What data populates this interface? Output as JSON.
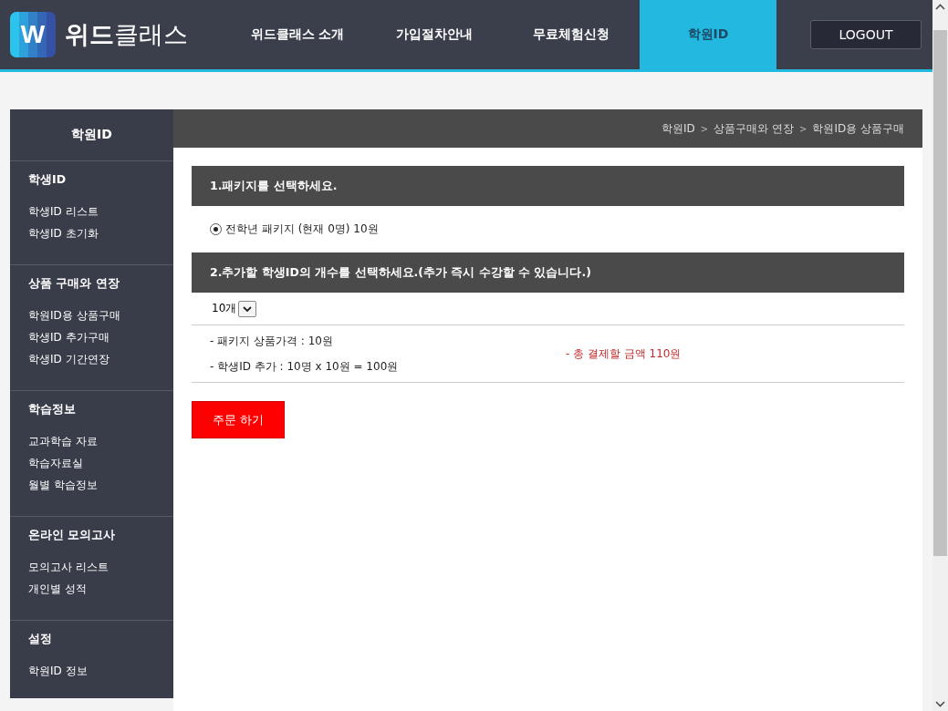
{
  "header": {
    "logo_letter": "W",
    "logo_text_bold": "위드",
    "logo_text": "클래스",
    "nav": [
      {
        "label": "위드클래스 소개",
        "selected": false
      },
      {
        "label": "가입절차안내",
        "selected": false
      },
      {
        "label": "무료체험신청",
        "selected": false
      },
      {
        "label": "학원ID",
        "selected": true
      }
    ],
    "logout": "LOGOUT"
  },
  "sidebar": {
    "title": "학원ID",
    "sections": [
      {
        "heading": "학생ID",
        "items": [
          "학생ID 리스트",
          "학생ID 초기화"
        ]
      },
      {
        "heading": "상품 구매와 연장",
        "items": [
          "학원ID용 상품구매",
          "학생ID 추가구매",
          "학생ID 기간연장"
        ]
      },
      {
        "heading": "학습정보",
        "items": [
          "교과학습 자료",
          "학습자료실",
          "월별 학습정보"
        ]
      },
      {
        "heading": "온라인 모의고사",
        "items": [
          "모의고사 리스트",
          "개인별 성적"
        ]
      },
      {
        "heading": "설정",
        "items": [
          "학원ID 정보"
        ]
      }
    ]
  },
  "breadcrumb": [
    {
      "kind": "link",
      "text": "학원ID"
    },
    {
      "kind": "separator",
      "text": ">"
    },
    {
      "kind": "link",
      "text": "상품구매와 연장"
    },
    {
      "kind": "separator",
      "text": ">"
    },
    {
      "kind": "link",
      "text": "학원ID용 상품구매"
    }
  ],
  "step1": {
    "title": "1.패키지를 선택하세요.",
    "options": [
      {
        "label": "전학년 패키지 (현재 0명) 10원",
        "selected": true
      }
    ]
  },
  "step2": {
    "title": "2.추가할 학생ID의 개수를 선택하세요.(추가 즉시 수강할 수 있습니다.)",
    "count": "10개"
  },
  "summary": {
    "lines": [
      "- 패키지 상품가격 : 10원",
      "- 학생ID 추가 : 10명 x 10원 = 100원"
    ],
    "total": "- 총 결제할 금액 110원"
  },
  "order_button": "주문 하기"
}
